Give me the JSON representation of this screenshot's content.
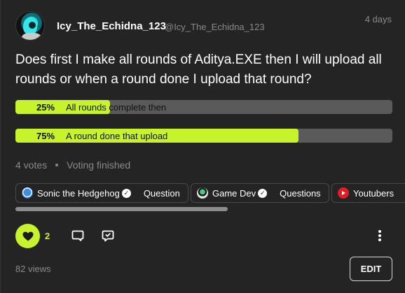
{
  "post": {
    "author": {
      "username": "Icy_The_Echidna_123",
      "handle": "@Icy_The_Echidna_123"
    },
    "time": "4 days",
    "question": "Does first I make all rounds of Aditya.EXE then I will upload all rounds or when a round done I upload that round?"
  },
  "poll": {
    "options": [
      {
        "percent_label": "25%",
        "label": "All rounds complete then",
        "fraction": 0.25
      },
      {
        "percent_label": "75%",
        "label": "A round done that upload",
        "fraction": 0.75
      }
    ],
    "votes": "4 votes",
    "status": "Voting finished"
  },
  "topics": [
    {
      "name": "Sonic the Hedgehog",
      "category": "Question",
      "icon": "sonic-icon"
    },
    {
      "name": "Game Dev",
      "category": "Questions",
      "icon": "gamedev-icon"
    },
    {
      "name": "Youtubers",
      "category": "",
      "icon": "youtube-icon"
    }
  ],
  "actions": {
    "likes": "2",
    "views": "82 views",
    "edit_label": "EDIT"
  },
  "colors": {
    "accent": "#c6f32b",
    "background": "#242424",
    "track": "#5a5a5a"
  }
}
